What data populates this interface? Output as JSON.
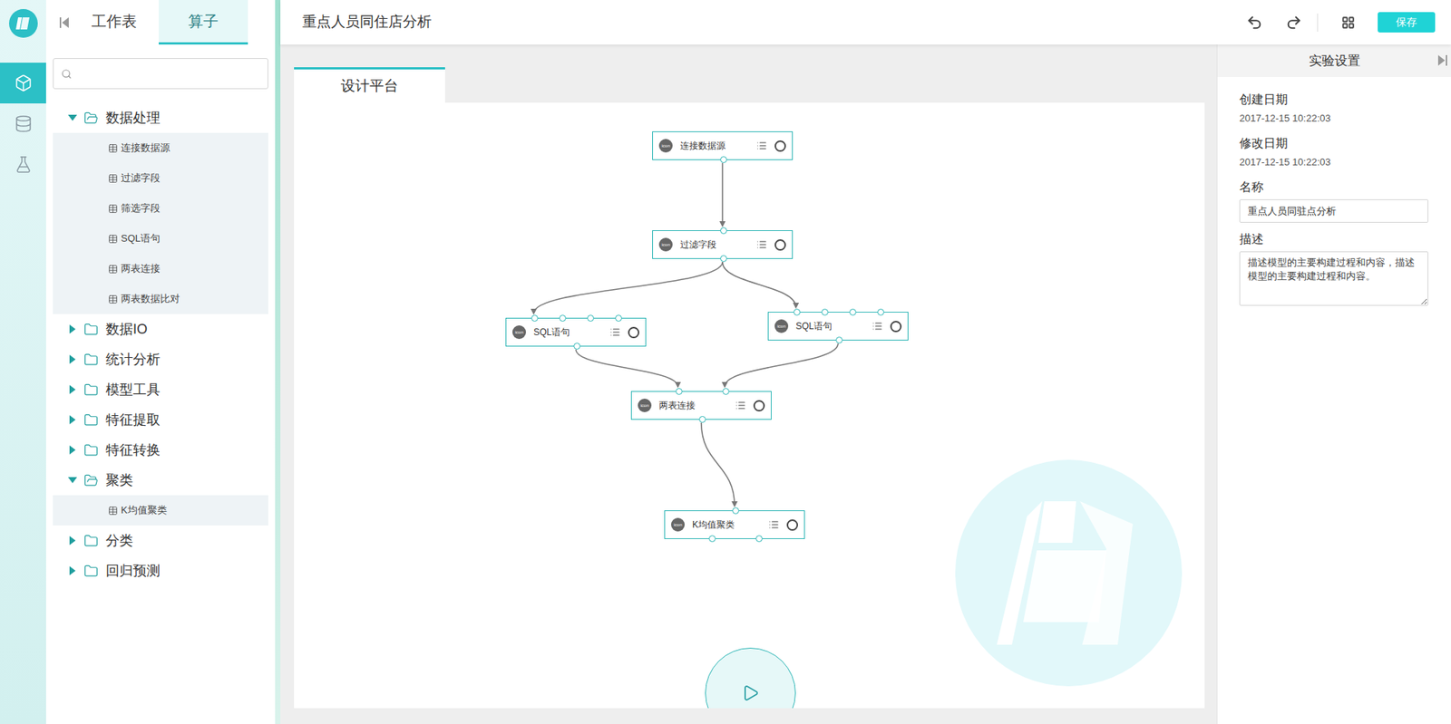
{
  "header": {
    "title": "重点人员同住店分析",
    "save": "保存"
  },
  "nav": [
    {
      "kind": "model",
      "selected": true
    },
    {
      "kind": "data",
      "selected": false
    },
    {
      "kind": "experiment",
      "selected": false
    }
  ],
  "panel_tabs": [
    {
      "label": "工作表",
      "selected": false
    },
    {
      "label": "算子",
      "selected": true
    }
  ],
  "tree": [
    {
      "label": "数据处理",
      "expanded": true,
      "children": [
        "连接数据源",
        "过滤字段",
        "筛选字段",
        "SQL语句",
        "两表连接",
        "两表数据比对"
      ]
    },
    {
      "label": "数据IO",
      "expanded": false,
      "children": []
    },
    {
      "label": "统计分析",
      "expanded": false,
      "children": []
    },
    {
      "label": "模型工具",
      "expanded": false,
      "children": []
    },
    {
      "label": "特征提取",
      "expanded": false,
      "children": []
    },
    {
      "label": "特征转换",
      "expanded": false,
      "children": []
    },
    {
      "label": "聚类",
      "expanded": true,
      "children": [
        "K均值聚类"
      ]
    },
    {
      "label": "分类",
      "expanded": false,
      "children": []
    },
    {
      "label": "回归预测",
      "expanded": false,
      "children": []
    }
  ],
  "canvas_tab": {
    "label": "设计平台",
    "selected": true
  },
  "nodes": [
    {
      "label": "连接数据源",
      "icon": "icon",
      "inputs": 0,
      "outputs": 1
    },
    {
      "label": "过滤字段",
      "icon": "icon",
      "inputs": 1,
      "outputs": 1
    },
    {
      "label": "SQL语句",
      "icon": "icon",
      "inputs": 4,
      "outputs": 1
    },
    {
      "label": "SQL语句",
      "icon": "icon",
      "inputs": 4,
      "outputs": 1
    },
    {
      "label": "两表连接",
      "icon": "icon",
      "inputs": 2,
      "outputs": 1
    },
    {
      "label": "K均值聚类",
      "icon": "icon",
      "inputs": 1,
      "outputs": 2
    }
  ],
  "edges": [
    {
      "from": 0,
      "out_port": 0,
      "to": 1,
      "in_port": 0
    },
    {
      "from": 1,
      "out_port": 0,
      "to": 2,
      "in_port": 0
    },
    {
      "from": 1,
      "out_port": 0,
      "to": 3,
      "in_port": 0
    },
    {
      "from": 2,
      "out_port": 0,
      "to": 4,
      "in_port": 0
    },
    {
      "from": 3,
      "out_port": 0,
      "to": 4,
      "in_port": 1
    },
    {
      "from": 4,
      "out_port": 0,
      "to": 5,
      "in_port": 0
    }
  ],
  "settings": {
    "title": "实验设置",
    "fields": [
      {
        "label": "创建日期",
        "value": "2017-12-15 10:22:03",
        "kind": "text"
      },
      {
        "label": "修改日期",
        "value": "2017-12-15 10:22:03",
        "kind": "text"
      },
      {
        "label": "名称",
        "value": "重点人员同驻点分析",
        "kind": "input"
      },
      {
        "label": "描述",
        "value": "描述模型的主要构建过程和内容，描述模型的主要构建过程和内容。",
        "kind": "textarea"
      }
    ]
  }
}
